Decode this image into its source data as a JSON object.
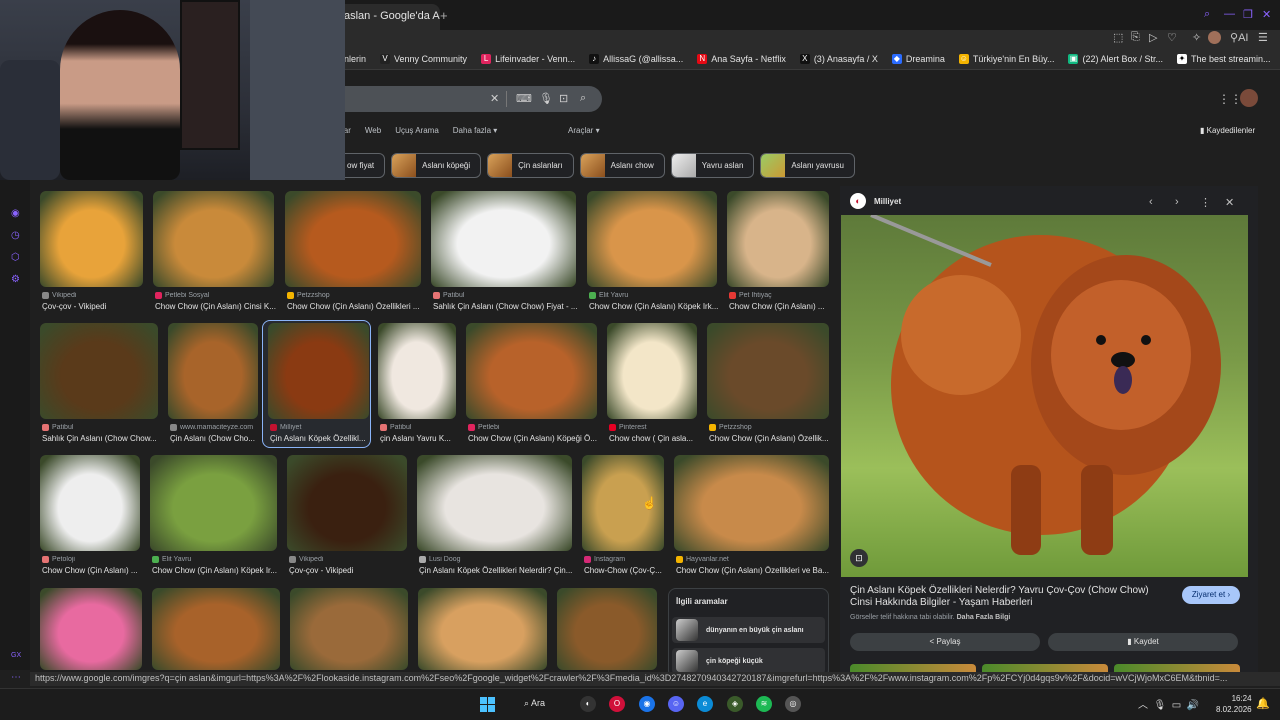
{
  "browser": {
    "tab_title": "aslan - Google'da Ara",
    "new_tab": "+",
    "ai_label": "AI",
    "bookmarks": [
      {
        "label": "nlerin",
        "color": "#444"
      },
      {
        "label": "Venny Community",
        "color": "#222",
        "glyph": "V"
      },
      {
        "label": "Lifeinvader - Venn...",
        "color": "#e0245e",
        "glyph": "L"
      },
      {
        "label": "AllissaG (@allissa...",
        "color": "#111",
        "glyph": "♪"
      },
      {
        "label": "Ana Sayfa - Netflix",
        "color": "#e50914",
        "glyph": "N"
      },
      {
        "label": "(3) Anasayfa / X",
        "color": "#111",
        "glyph": "X"
      },
      {
        "label": "Dreamina",
        "color": "#2b6cff",
        "glyph": "◆"
      },
      {
        "label": "Türkiye'nin En Büy...",
        "color": "#f4b400",
        "glyph": "☺"
      },
      {
        "label": "(22) Alert Box / Str...",
        "color": "#10b981",
        "glyph": "▣"
      },
      {
        "label": "The best streamin...",
        "color": "#fff",
        "glyph": "✦"
      }
    ],
    "status_url": "https://www.google.com/imgres?q=çin aslan&imgurl=https%3A%2F%2Flookaside.instagram.com%2Fseo%2Fgoogle_widget%2Fcrawler%2F%3Fmedia_id%3D2748270940342720187&imgrefurl=https%3A%2F%2Fwww.instagram.com%2Fp%2FCYj0d4gqs9v%2F&docid=wVCjWjoMxC6EM&tbnid=..."
  },
  "search": {
    "filters": [
      "lar",
      "Web",
      "Uçuş Arama",
      "Daha fazla ▾"
    ],
    "tools": "Araçlar ▾",
    "saved": "Kaydedilenler",
    "chips": [
      "ow fiyat",
      "Aslanı köpeği",
      "Çin aslanları",
      "Aslanı chow",
      "Yavru aslan",
      "Aslanı yavrusu"
    ]
  },
  "results": [
    {
      "source": "Vikipedi",
      "caption": "Çov-çov - Vikipedi",
      "color": "#e8a33a",
      "srcColor": "#888"
    },
    {
      "source": "Petlebi Sosyal",
      "caption": "Chow Chow (Çin Aslanı) Cinsi K...",
      "color": "#c98a3a",
      "srcColor": "#e0245e"
    },
    {
      "source": "Petzzshop",
      "caption": "Chow Chow (Çin Aslanı) Özellikleri ...",
      "color": "#b65a1e",
      "srcColor": "#f4b400"
    },
    {
      "source": "Patibul",
      "caption": "Sahlık Çin Aslanı (Chow Chow) Fiyat - ...",
      "color": "#f2f2f2",
      "srcColor": "#e57373"
    },
    {
      "source": "Elit Yavru",
      "caption": "Chow Chow (Çin Aslanı) Köpek Irk...",
      "color": "#d9954a",
      "srcColor": "#4caf50"
    },
    {
      "source": "Pet İhtiyaç",
      "caption": "Chow Chow (Çin Aslanı) ...",
      "color": "#d8b48a",
      "srcColor": "#e53935"
    },
    {
      "source": "Patibul",
      "caption": "Sahlık Çin Aslanı (Chow Chow...",
      "color": "#5a3a1a",
      "srcColor": "#e57373"
    },
    {
      "source": "www.mamaciteyze.com",
      "caption": "Çin Aslanı (Chow Cho...",
      "color": "#a8642a",
      "srcColor": "#888"
    },
    {
      "source": "Milliyet",
      "caption": "Çin Aslanı Köpek Özellikl...",
      "color": "#8a3a12",
      "srcColor": "#c41230"
    },
    {
      "source": "Patibul",
      "caption": "çin Aslanı Yavru K...",
      "color": "#f0e8e0",
      "srcColor": "#e57373"
    },
    {
      "source": "Petlebi",
      "caption": "Chow Chow (Çin Aslanı) Köpeği Ö...",
      "color": "#b8622a",
      "srcColor": "#e0245e"
    },
    {
      "source": "Pinterest",
      "caption": "Chow chow ( Çin asla...",
      "color": "#f3e6c8",
      "srcColor": "#e60023"
    },
    {
      "source": "Petzzshop",
      "caption": "Chow Chow (Çin Aslanı) Özellik...",
      "color": "#6a4a2a",
      "srcColor": "#f4b400"
    },
    {
      "source": "Petoloji",
      "caption": "Chow Chow (Çin Aslanı) ...",
      "color": "#eeeeee",
      "srcColor": "#e57373"
    },
    {
      "source": "Elit Yavru",
      "caption": "Chow Chow (Çin Aslanı) Köpek Ir...",
      "color": "#7aa040",
      "srcColor": "#4caf50"
    },
    {
      "source": "Vikipedi",
      "caption": "Çov-çov - Vikipedi",
      "color": "#3a2010",
      "srcColor": "#888"
    },
    {
      "source": "Lusi Doog",
      "caption": "Çin Aslanı Köpek Özellikleri Nelerdir? Çin...",
      "color": "#e8e4e0",
      "srcColor": "#aaa"
    },
    {
      "source": "Instagram",
      "caption": "Chow-Chow (Çov-Ç...",
      "color": "#c9a050",
      "srcColor": "#d62976"
    },
    {
      "source": "Hayvanlar.net",
      "caption": "Chow Chow (Çin Aslanı) Özellikleri ve Ba...",
      "color": "#c88a4a",
      "srcColor": "#f4b400"
    },
    {
      "source": "",
      "caption": "",
      "color": "#e86aa0",
      "srcColor": "#888"
    },
    {
      "source": "",
      "caption": "",
      "color": "#a8622a",
      "srcColor": "#888"
    },
    {
      "source": "",
      "caption": "",
      "color": "#9a6a3a",
      "srcColor": "#888"
    },
    {
      "source": "",
      "caption": "",
      "color": "#d8a060",
      "srcColor": "#888"
    },
    {
      "source": "",
      "caption": "",
      "color": "#8a5a2a",
      "srcColor": "#888"
    }
  ],
  "related": {
    "title": "İlgili aramalar",
    "items": [
      "dünyanın en büyük çin aslanı",
      "çin köpeği küçük"
    ]
  },
  "panel": {
    "source": "Milliyet",
    "source_glyph": "◐",
    "title": "Çin Aslanı Köpek Özellikleri Nelerdir? Yavru Çov-Çov (Chow Chow) Cinsi Hakkında Bilgiler - Yaşam Haberleri",
    "visit": "Ziyaret et ›",
    "copyright_prefix": "Görseller telif hakkına tabi olabilir.",
    "copyright_link": "Daha Fazla Bilgi",
    "share": "Paylaş",
    "save": "Kaydet"
  },
  "taskbar": {
    "search": "Ara",
    "time": "16:24",
    "date": "8.02.2026"
  },
  "rail_label": "GX"
}
